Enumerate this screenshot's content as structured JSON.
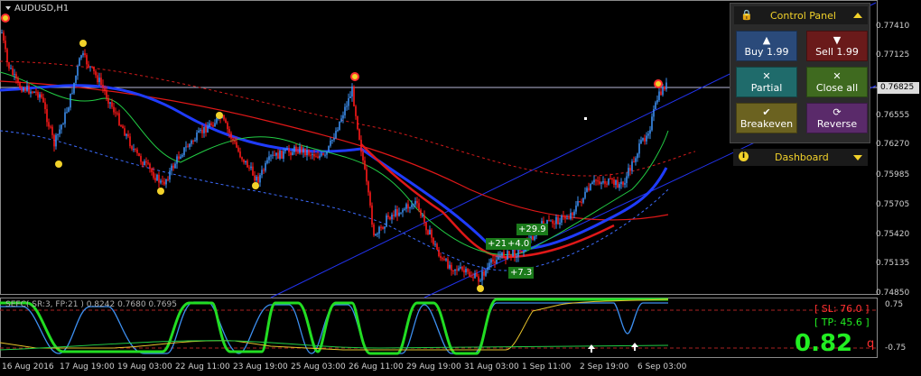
{
  "symbol_label": "AUDUSD,H1",
  "current_price": "0.76825",
  "price_axis": [
    "0.77410",
    "0.77125",
    "0.76555",
    "0.76270",
    "0.75985",
    "0.75705",
    "0.75420",
    "0.75135",
    "0.74850"
  ],
  "time_axis": [
    "16 Aug 2016",
    "17 Aug 19:00",
    "19 Aug 03:00",
    "22 Aug 11:00",
    "23 Aug 19:00",
    "25 Aug 03:00",
    "26 Aug 11:00",
    "29 Aug 19:00",
    "31 Aug 03:00",
    "1 Sep 11:00",
    "2 Sep 19:00",
    "6 Sep 03:00"
  ],
  "trade_labels": [
    "+21.0",
    "+4.0",
    "+29.9",
    "+7.3"
  ],
  "control_panel": {
    "title": "Control Panel",
    "buy": "Buy 1.99",
    "sell": "Sell 1.99",
    "partial": "Partial",
    "close_all": "Close all",
    "breakeven": "Breakeven",
    "reverse": "Reverse",
    "dashboard": "Dashboard"
  },
  "oscillator": {
    "label": "SEFC( SR:3, FP:21 ) 0.8242 0.7680 0.7695",
    "right_scale": [
      "0.75",
      "-0.75"
    ],
    "sl": "[ SL: 76.0 ]",
    "tp": "[ TP: 45.6 ]",
    "value": "0.82",
    "q": "q"
  },
  "colors": {
    "bull": "#3d8ff0",
    "bear": "#ff1a1a",
    "ma_blue": "#1f3cff",
    "ma_red": "#e01818",
    "ma_green": "#22cc44",
    "accent_yellow": "#f2d22a"
  }
}
